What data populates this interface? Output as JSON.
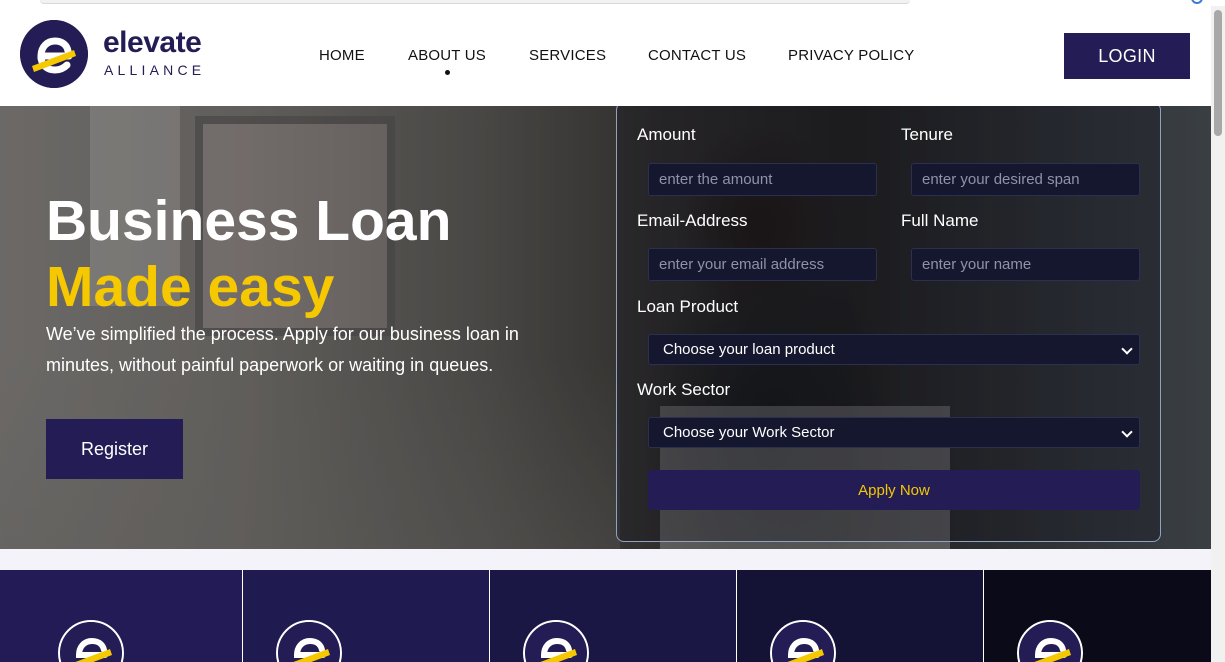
{
  "brand": {
    "name": "elevate",
    "tagline": "ALLIANCE",
    "logo_icon": "elevate-e-logo",
    "colors": {
      "primary": "#241c54",
      "accent": "#f5c800"
    }
  },
  "nav": {
    "items": [
      {
        "label": "HOME"
      },
      {
        "label": "ABOUT US",
        "active": true
      },
      {
        "label": "SERVICES"
      },
      {
        "label": "CONTACT US"
      },
      {
        "label": "PRIVACY POLICY"
      }
    ],
    "login_label": "LOGIN"
  },
  "hero": {
    "title_line1": "Business Loan",
    "title_line2": "Made easy",
    "description": "We’ve simplified the process. Apply for our business loan in minutes, without painful paperwork or waiting in queues.",
    "register_label": "Register"
  },
  "form": {
    "amount_label": "Amount",
    "amount_placeholder": "enter the amount",
    "tenure_label": "Tenure",
    "tenure_placeholder": "enter your desired span",
    "email_label": "Email-Address",
    "email_placeholder": "enter your email address",
    "name_label": "Full Name",
    "name_placeholder": "enter your name",
    "product_label": "Loan Product",
    "product_value": "Choose your loan product",
    "sector_label": "Work Sector",
    "sector_value": "Choose your Work Sector",
    "apply_label": "Apply Now"
  },
  "feature_cards": {
    "colors": [
      "#221b55",
      "#1f1a50",
      "#1a1745",
      "#141235",
      "#0b0a18"
    ],
    "icon": "elevate-e-logo"
  }
}
